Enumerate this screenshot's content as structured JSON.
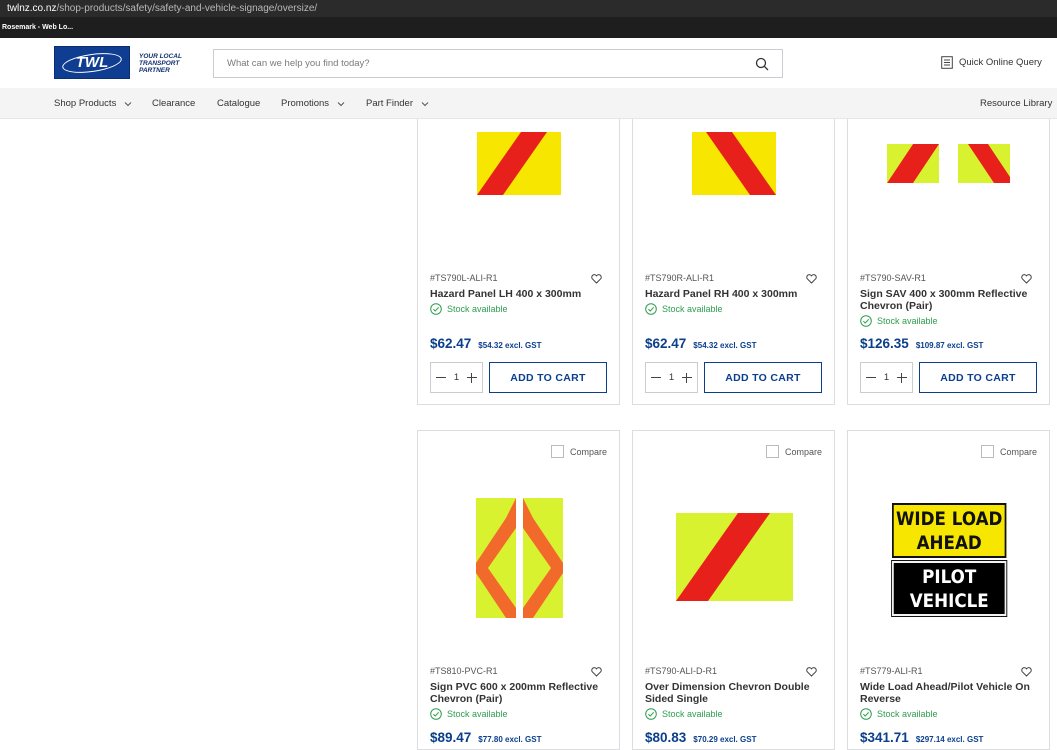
{
  "browser": {
    "url_host": "twlnz.co.nz",
    "url_path": "/shop-products/safety/safety-and-vehicle-signage/oversize/",
    "bookmark": "Rosemark - Web Lo..."
  },
  "header": {
    "logo_text": "TWL",
    "tagline": [
      "YOUR LOCAL",
      "TRANSPORT",
      "PARTNER"
    ],
    "search_placeholder": "What can we help you find today?",
    "quick_query": "Quick Online Query"
  },
  "nav": {
    "items": [
      "Shop Products",
      "Clearance",
      "Catalogue",
      "Promotions",
      "Part Finder"
    ],
    "resource_library": "Resource Library"
  },
  "compare_label": "Compare",
  "add_to_cart_label": "ADD TO CART",
  "stock_label": "Stock available",
  "products": [
    {
      "sku": "#TS790L-ALI-R1",
      "title": "Hazard Panel LH 400 x 300mm",
      "price": "$62.47",
      "excl": "$54.32 excl. GST",
      "qty": "1"
    },
    {
      "sku": "#TS790R-ALI-R1",
      "title": "Hazard Panel RH 400 x 300mm",
      "price": "$62.47",
      "excl": "$54.32 excl. GST",
      "qty": "1"
    },
    {
      "sku": "#TS790-SAV-R1",
      "title": "Sign SAV 400 x 300mm Reflective Chevron (Pair)",
      "price": "$126.35",
      "excl": "$109.87 excl. GST",
      "qty": "1"
    },
    {
      "sku": "#TS810-PVC-R1",
      "title": "Sign PVC 600 x 200mm Reflective Chevron (Pair)",
      "price": "$89.47",
      "excl": "$77.80 excl. GST"
    },
    {
      "sku": "#TS790-ALI-D-R1",
      "title": "Over Dimension Chevron Double Sided Single",
      "price": "$80.83",
      "excl": "$70.29 excl. GST"
    },
    {
      "sku": "#TS779-ALI-R1",
      "title": "Wide Load Ahead/Pilot Vehicle On Reverse",
      "price": "$341.71",
      "excl": "$297.14 excl. GST"
    }
  ],
  "wide_load_sign": {
    "top_lines": [
      "WIDE LOAD",
      "AHEAD"
    ],
    "bottom_lines": [
      "PILOT",
      "VEHICLE"
    ]
  },
  "colors": {
    "brand_blue": "#0b3f8c",
    "stock_green": "#2e9e4f",
    "hazard_red": "#e8201c",
    "hazard_yellow": "#f7e600",
    "chevron_lime": "#d8f230"
  }
}
